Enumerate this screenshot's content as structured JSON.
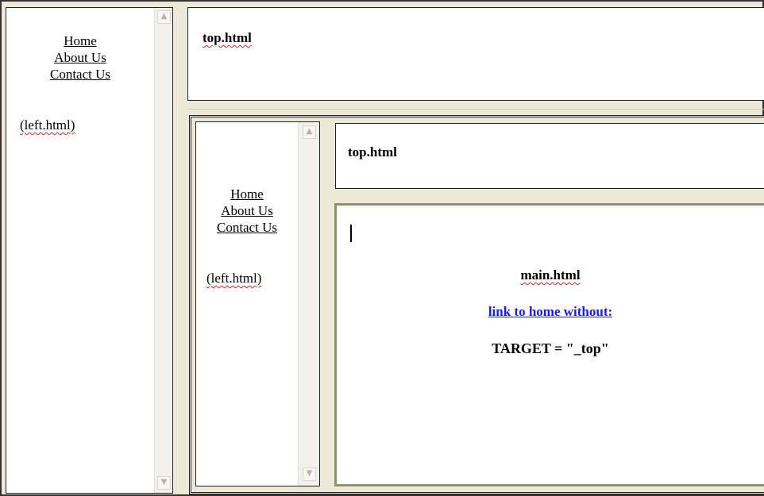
{
  "left": {
    "nav": [
      "Home",
      "About Us",
      "Contact Us"
    ],
    "note": "(left.html)"
  },
  "top": {
    "title": "top.html"
  },
  "inner": {
    "left": {
      "nav": [
        "Home",
        "About Us",
        "Contact Us"
      ],
      "note": "(left.html)"
    },
    "top": {
      "title": "top.html"
    },
    "main": {
      "title": "main.html",
      "link": "link to home without:",
      "target": "TARGET = \"_top\""
    }
  },
  "icons": {
    "scroll_up": "▲",
    "scroll_down": "▼"
  },
  "colors": {
    "link_blue": "#1a1aee",
    "frame_bg": "#ece9d8",
    "main_border": "#8a9670"
  }
}
